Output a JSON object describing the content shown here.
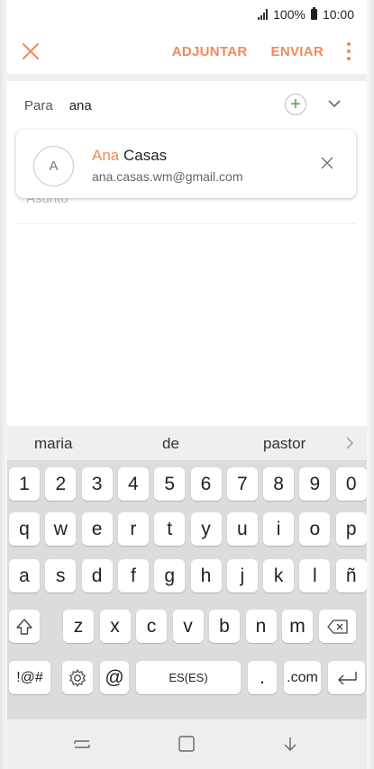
{
  "status_bar": {
    "battery": "100%",
    "time": "10:00"
  },
  "toolbar": {
    "attach_label": "ADJUNTAR",
    "send_label": "ENVIAR",
    "accent_color": "#f2885b"
  },
  "compose": {
    "to_label": "Para",
    "to_value": "ana",
    "subject_placeholder": "Asunto"
  },
  "suggestion": {
    "avatar_letter": "A",
    "name_match": "Ana",
    "name_rest": " Casas",
    "email": "ana.casas.wm@gmail.com"
  },
  "keyboard": {
    "predictions": [
      "maria",
      "de",
      "pastor"
    ],
    "row_numbers": [
      "1",
      "2",
      "3",
      "4",
      "5",
      "6",
      "7",
      "8",
      "9",
      "0"
    ],
    "row_q": [
      "q",
      "w",
      "e",
      "r",
      "t",
      "y",
      "u",
      "i",
      "o",
      "p"
    ],
    "row_a": [
      "a",
      "s",
      "d",
      "f",
      "g",
      "h",
      "j",
      "k",
      "l",
      "ñ"
    ],
    "row_z": [
      "z",
      "x",
      "c",
      "v",
      "b",
      "n",
      "m"
    ],
    "symbols_label": "!@#",
    "at_label": "@",
    "space_label": "ES(ES)",
    "period_label": ".",
    "dotcom_label": ".com"
  },
  "icons": {
    "close": "close-icon",
    "more": "more-vert-icon",
    "add": "add-contact-icon",
    "expand": "chevron-down-icon",
    "shift": "shift-icon",
    "backspace": "backspace-icon",
    "settings": "gear-icon",
    "enter": "enter-icon",
    "recent": "recent-apps-icon",
    "home": "home-icon",
    "back": "back-icon"
  }
}
